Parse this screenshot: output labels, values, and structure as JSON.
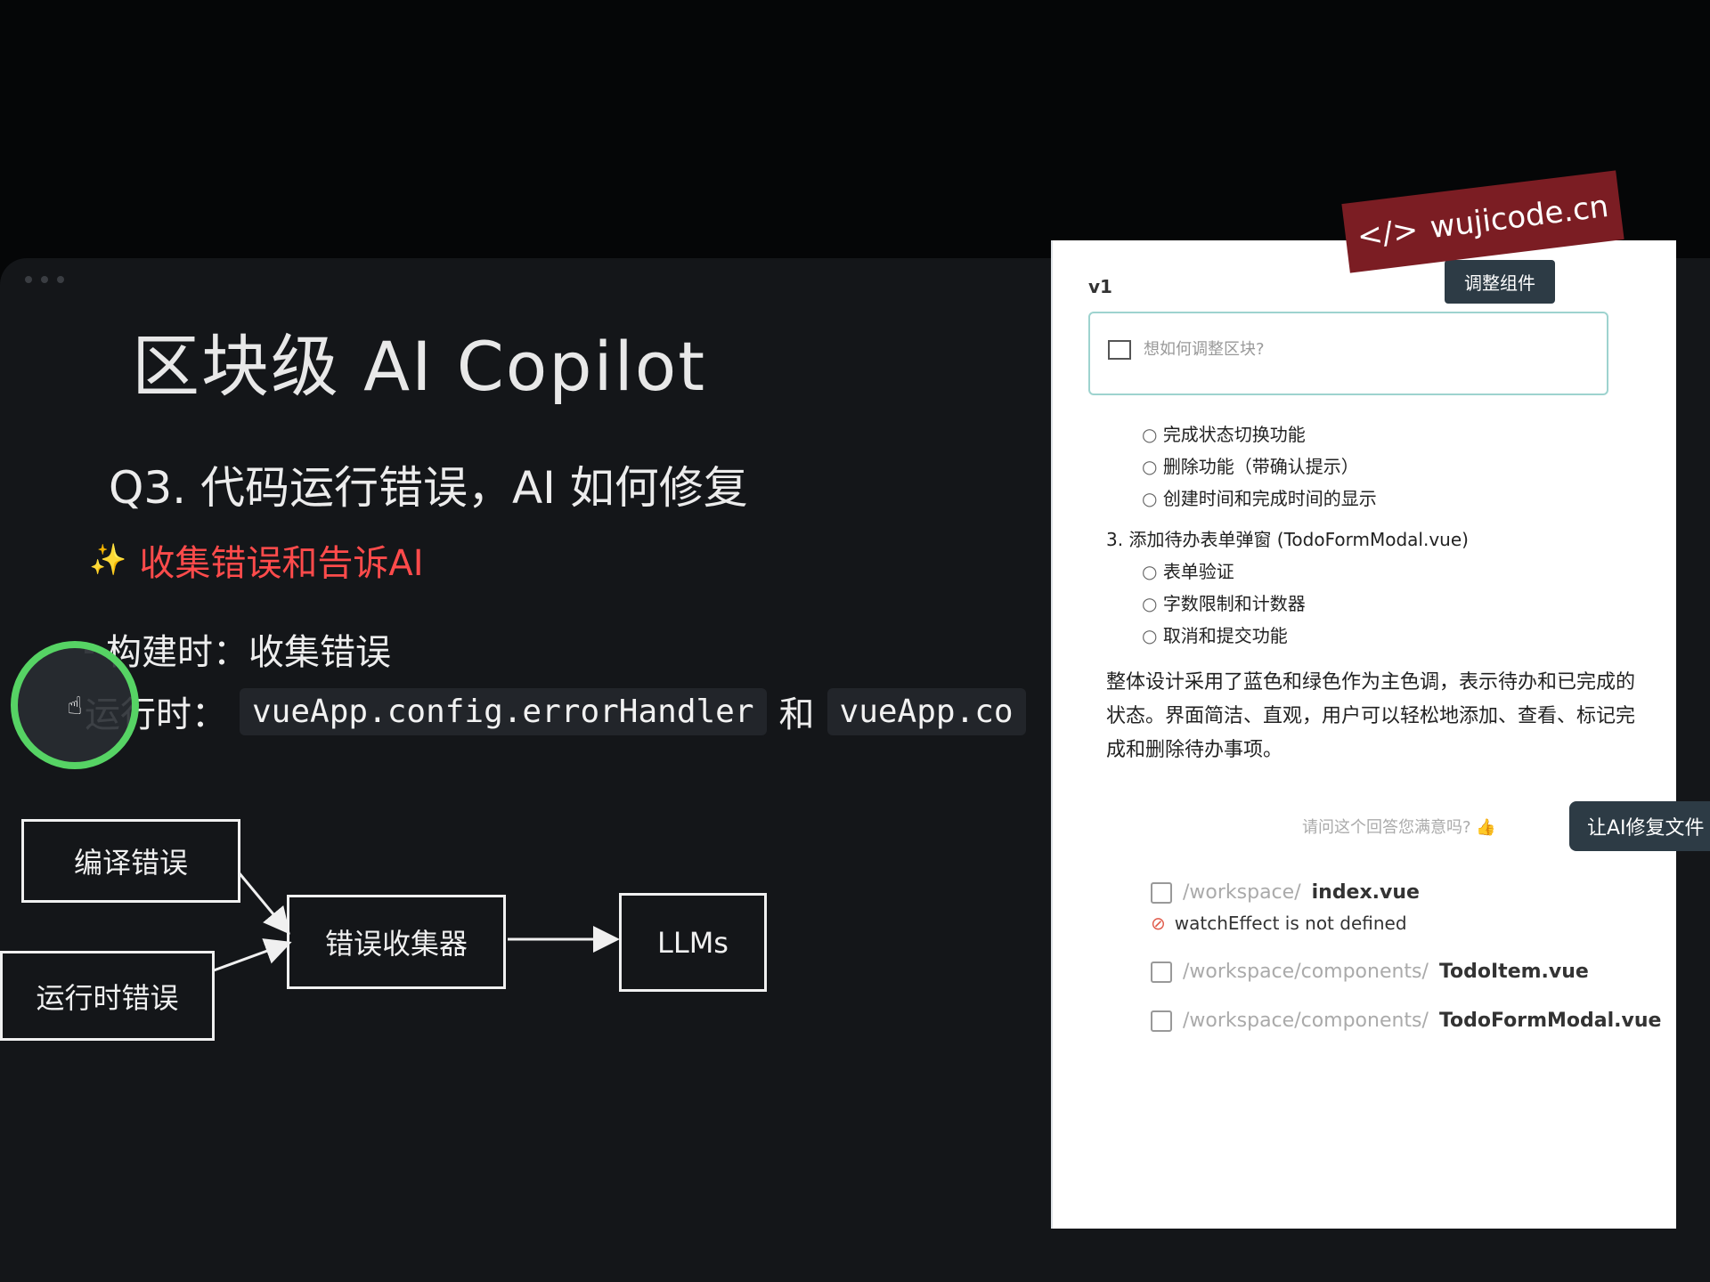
{
  "slide": {
    "title": "区块级 AI Copilot",
    "question": "Q3. 代码运行错误，AI 如何修复",
    "point": "收集错误和告诉AI",
    "bullets": {
      "build_label": "构建时：收集错误",
      "runtime_label": "运行时：",
      "runtime_code1": "vueApp.config.errorHandler",
      "runtime_and": "和",
      "runtime_code2": "vueApp.co"
    },
    "diagram": {
      "compile_errors": "编译错误",
      "runtime_errors": "运行时错误",
      "collector": "错误收集器",
      "llms": "LLMs"
    }
  },
  "panel": {
    "brand": "wujicode.cn",
    "version": "v1",
    "adjust_button": "调整组件",
    "prompt_placeholder": "想如何调整区块?",
    "list_items": [
      "完成状态切换功能",
      "删除功能（带确认提示）",
      "创建时间和完成时间的显示"
    ],
    "step3_title": "3. 添加待办表单弹窗 (TodoFormModal.vue)",
    "step3_items": [
      "表单验证",
      "字数限制和计数器",
      "取消和提交功能"
    ],
    "summary": "整体设计采用了蓝色和绿色作为主色调，表示待办和已完成的状态。界面简洁、直观，用户可以轻松地添加、查看、标记完成和删除待办事项。",
    "feedback": "请问这个回答您满意吗?",
    "fix_button": "让AI修复文件",
    "files": [
      {
        "dir": "/workspace/",
        "name": "index.vue"
      },
      {
        "dir": "/workspace/components/",
        "name": "TodoItem.vue"
      },
      {
        "dir": "/workspace/components/",
        "name": "TodoFormModal.vue"
      }
    ],
    "error_text": "watchEffect is not defined"
  }
}
